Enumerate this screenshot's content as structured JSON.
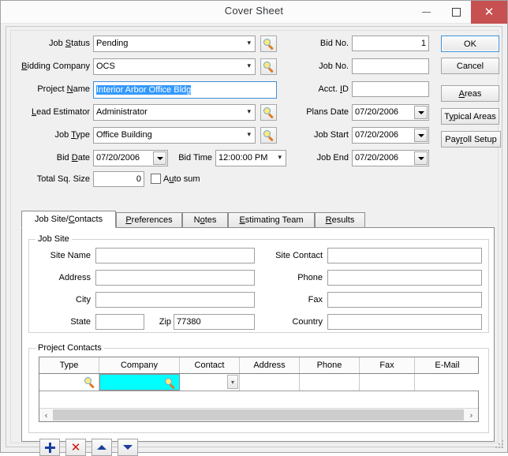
{
  "window": {
    "title": "Cover Sheet",
    "minimize_label": "Minimize",
    "maximize_label": "Maximize",
    "close_label": "Close"
  },
  "left_form": {
    "job_status": {
      "label": "Job Status",
      "value": "Pending",
      "lookup": "search-icon"
    },
    "bidding_company": {
      "label": "Bidding Company",
      "value": "OCS",
      "lookup": "search-icon"
    },
    "project_name": {
      "label": "Project Name",
      "value": "Interior Arbor Office Bldg"
    },
    "lead_estimator": {
      "label": "Lead Estimator",
      "value": "Administrator",
      "lookup": "search-icon"
    },
    "job_type": {
      "label": "Job Type",
      "value": "Office Building",
      "lookup": "search-icon"
    },
    "bid_date": {
      "label": "Bid Date",
      "value": "07/20/2006"
    },
    "bid_time": {
      "label": "Bid Time",
      "value": "12:00:00 PM"
    },
    "total_sq_size": {
      "label": "Total Sq. Size",
      "value": "0"
    },
    "auto_sum": {
      "label": "Auto sum",
      "checked": false
    }
  },
  "right_form": {
    "bid_no": {
      "label": "Bid No.",
      "value": "1"
    },
    "job_no": {
      "label": "Job No.",
      "value": ""
    },
    "acct_id": {
      "label": "Acct. ID",
      "value": ""
    },
    "plans_date": {
      "label": "Plans Date",
      "value": "07/20/2006"
    },
    "job_start": {
      "label": "Job Start",
      "value": "07/20/2006"
    },
    "job_end": {
      "label": "Job End",
      "value": "07/20/2006"
    }
  },
  "action_buttons": {
    "ok": "OK",
    "cancel": "Cancel",
    "areas": "Areas",
    "typical_areas": "Typical Areas",
    "payroll_setup": "Payroll Setup"
  },
  "tabs": {
    "active_index": 0,
    "items": [
      {
        "label": "Job Site/Contacts"
      },
      {
        "label": "Preferences"
      },
      {
        "label": "Notes"
      },
      {
        "label": "Estimating Team"
      },
      {
        "label": "Results"
      }
    ]
  },
  "job_site": {
    "group_title": "Job Site",
    "site_name": {
      "label": "Site Name",
      "value": ""
    },
    "address": {
      "label": "Address",
      "value": ""
    },
    "city": {
      "label": "City",
      "value": ""
    },
    "state": {
      "label": "State",
      "value": ""
    },
    "zip": {
      "label": "Zip",
      "value": "77380"
    },
    "site_contact": {
      "label": "Site Contact",
      "value": ""
    },
    "phone": {
      "label": "Phone",
      "value": ""
    },
    "fax": {
      "label": "Fax",
      "value": ""
    },
    "country": {
      "label": "Country",
      "value": ""
    }
  },
  "project_contacts": {
    "group_title": "Project Contacts",
    "columns": [
      "Type",
      "Company",
      "Contact",
      "Address",
      "Phone",
      "Fax",
      "E-Mail"
    ],
    "rows": [
      {
        "type": "",
        "company": "",
        "contact": "",
        "address": "",
        "phone": "",
        "fax": "",
        "email": ""
      }
    ],
    "selected_cell": "company",
    "selected_cell_color": "#00FFFF",
    "toolbar": {
      "add": "add-row-button",
      "delete": "delete-row-button",
      "move_up": "move-row-up-button",
      "move_down": "move-row-down-button"
    },
    "scroll_left": "‹",
    "scroll_right": "›"
  },
  "colors": {
    "selection_blue": "#3399FF",
    "focus_border": "#3C8FD9",
    "close_button": "#C75050",
    "cell_highlight": "#00FFFF"
  }
}
